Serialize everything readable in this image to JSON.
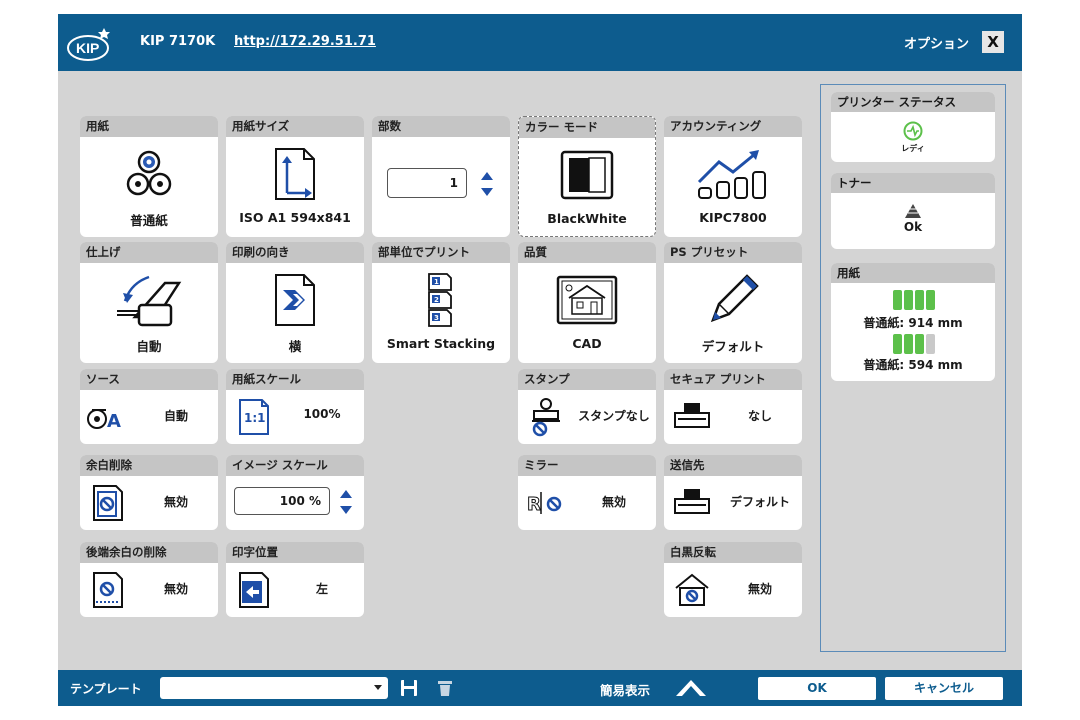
{
  "header": {
    "model": "KIP 7170K",
    "url": "http://172.29.51.71",
    "options": "オプション",
    "close": "X"
  },
  "tiles": {
    "paper": {
      "title": "用紙",
      "value": "普通紙"
    },
    "paper_size": {
      "title": "用紙サイズ",
      "value": "ISO A1 594x841"
    },
    "copies": {
      "title": "部数",
      "value": "1"
    },
    "color_mode": {
      "title": "カラー モード",
      "value": "BlackWhite"
    },
    "accounting": {
      "title": "アカウンティング",
      "value": "KIPC7800"
    },
    "finishing": {
      "title": "仕上げ",
      "value": "自動"
    },
    "orientation": {
      "title": "印刷の向き",
      "value": "横"
    },
    "collate": {
      "title": "部単位でプリント",
      "value": "Smart Stacking"
    },
    "quality": {
      "title": "品質",
      "value": "CAD"
    },
    "ps_preset": {
      "title": "PS プリセット",
      "value": "デフォルト"
    },
    "source": {
      "title": "ソース",
      "value": "自動"
    },
    "paper_scale": {
      "title": "用紙スケール",
      "value": "100%",
      "icon_text": "1:1"
    },
    "stamp": {
      "title": "スタンプ",
      "value": "スタンプなし"
    },
    "secure_print": {
      "title": "セキュア プリント",
      "value": "なし"
    },
    "margin_removal": {
      "title": "余白削除",
      "value": "無効"
    },
    "image_scale": {
      "title": "イメージ スケール",
      "value": "100 %"
    },
    "mirror": {
      "title": "ミラー",
      "value": "無効"
    },
    "destination": {
      "title": "送信先",
      "value": "デフォルト"
    },
    "trailing_margin": {
      "title": "後端余白の削除",
      "value": "無効"
    },
    "print_position": {
      "title": "印字位置",
      "value": "左"
    },
    "invert": {
      "title": "白黒反転",
      "value": "無効"
    }
  },
  "status": {
    "printer": {
      "title": "プリンター ステータス",
      "state": "レディ"
    },
    "toner": {
      "title": "トナー",
      "state": "Ok"
    },
    "paper": {
      "title": "用紙",
      "rolls": [
        {
          "label": "普通紙: 914 mm",
          "level_bars": 4,
          "of": 4
        },
        {
          "label": "普通紙: 594 mm",
          "level_bars": 3,
          "of": 4
        }
      ]
    }
  },
  "footer": {
    "template_label": "テンプレート",
    "template_value": "",
    "simple_view": "簡易表示",
    "ok": "OK",
    "cancel": "キャンセル"
  },
  "colors": {
    "brand_blue": "#0d5c8e",
    "accent_blue": "#1f4fa8",
    "status_green": "#5cc04a"
  }
}
